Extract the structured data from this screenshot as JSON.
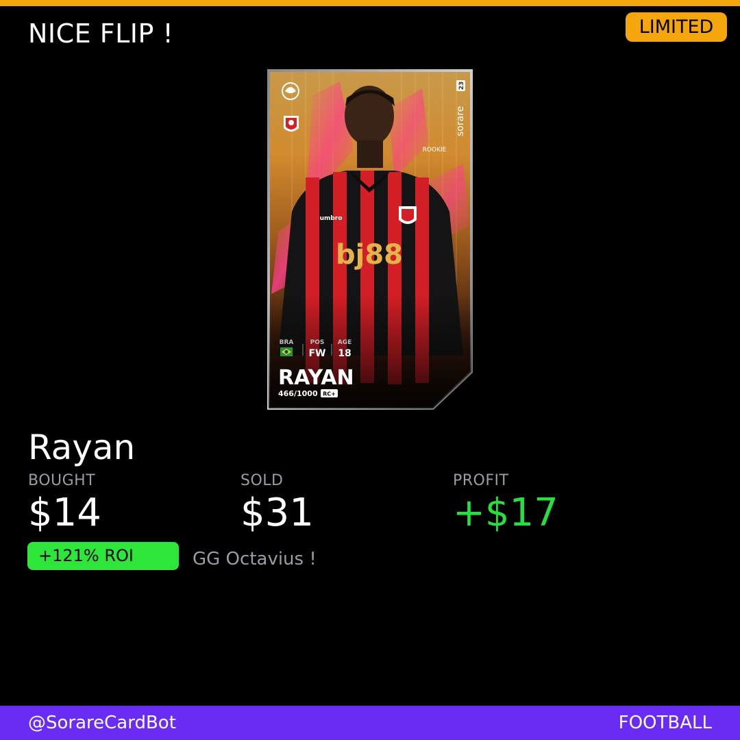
{
  "header": {
    "title": "NICE FLIP !",
    "rarity": "LIMITED"
  },
  "card": {
    "league_icon": "premier-league-lion-icon",
    "club_icon": "afc-bournemouth-crest-icon",
    "brand": "sorare",
    "season": "23",
    "tag": "ROOKIE",
    "sponsor": "bj88",
    "kit_brand": "umbro",
    "nationality_label": "BRA",
    "flag_icon": "brazil-flag-icon",
    "position_label": "POS",
    "position": "FW",
    "age_label": "AGE",
    "age": "18",
    "name": "RAYAN",
    "serial": "466/1000",
    "serial_badge": "RC+"
  },
  "player": {
    "name": "Rayan"
  },
  "stats": {
    "bought_label": "BOUGHT",
    "bought_value": "$14",
    "sold_label": "SOLD",
    "sold_value": "$31",
    "profit_label": "PROFIT",
    "profit_value": "+$17"
  },
  "roi": {
    "label": "+121% ROI"
  },
  "message": "GG Octavius !",
  "footer": {
    "handle": "@SorareCardBot",
    "sport": "FOOTBALL"
  },
  "colors": {
    "accent_orange": "#f4a60c",
    "profit_green": "#26e03f",
    "roi_green": "#2ee53a",
    "footer_purple": "#6a2cf4",
    "label_grey": "#9a9ca6"
  }
}
